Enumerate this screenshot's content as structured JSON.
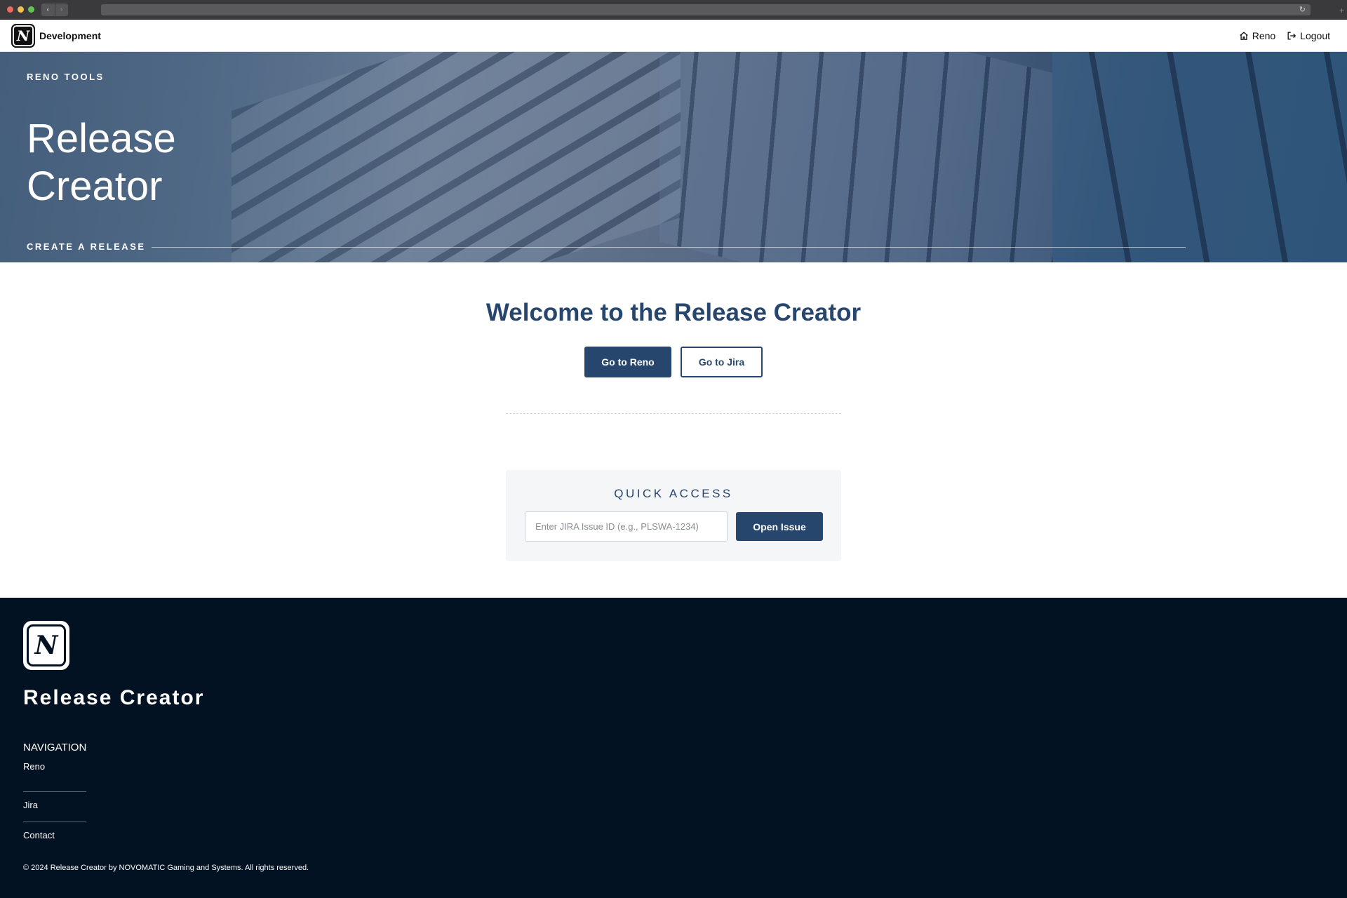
{
  "browser": {
    "back_glyph": "‹",
    "forward_glyph": "›",
    "reload_glyph": "↻",
    "newtab_glyph": "+"
  },
  "topnav": {
    "logo_letter": "N",
    "brand": "Development",
    "links": [
      {
        "label": "Reno",
        "icon": "home-icon"
      },
      {
        "label": "Logout",
        "icon": "logout-icon"
      }
    ]
  },
  "hero": {
    "eyebrow": "RENO TOOLS",
    "title": "Release Creator",
    "subtitle": "CREATE A RELEASE"
  },
  "main": {
    "welcome": "Welcome to the Release Creator",
    "buttons": {
      "reno": "Go to Reno",
      "jira": "Go to Jira"
    },
    "quick_access": {
      "title": "QUICK ACCESS",
      "input_placeholder": "Enter JIRA Issue ID (e.g., PLSWA-1234)",
      "input_value": "",
      "button": "Open Issue"
    }
  },
  "footer": {
    "logo_letter": "N",
    "title": "Release Creator",
    "nav_heading": "NAVIGATION",
    "links": [
      "Reno",
      "Jira",
      "Contact"
    ],
    "copyright": "© 2024 Release Creator by NOVOMATIC Gaming and Systems. All rights reserved."
  },
  "colors": {
    "primary": "#27466e",
    "footer_bg": "#031222",
    "quick_bg": "#f5f6f8"
  }
}
